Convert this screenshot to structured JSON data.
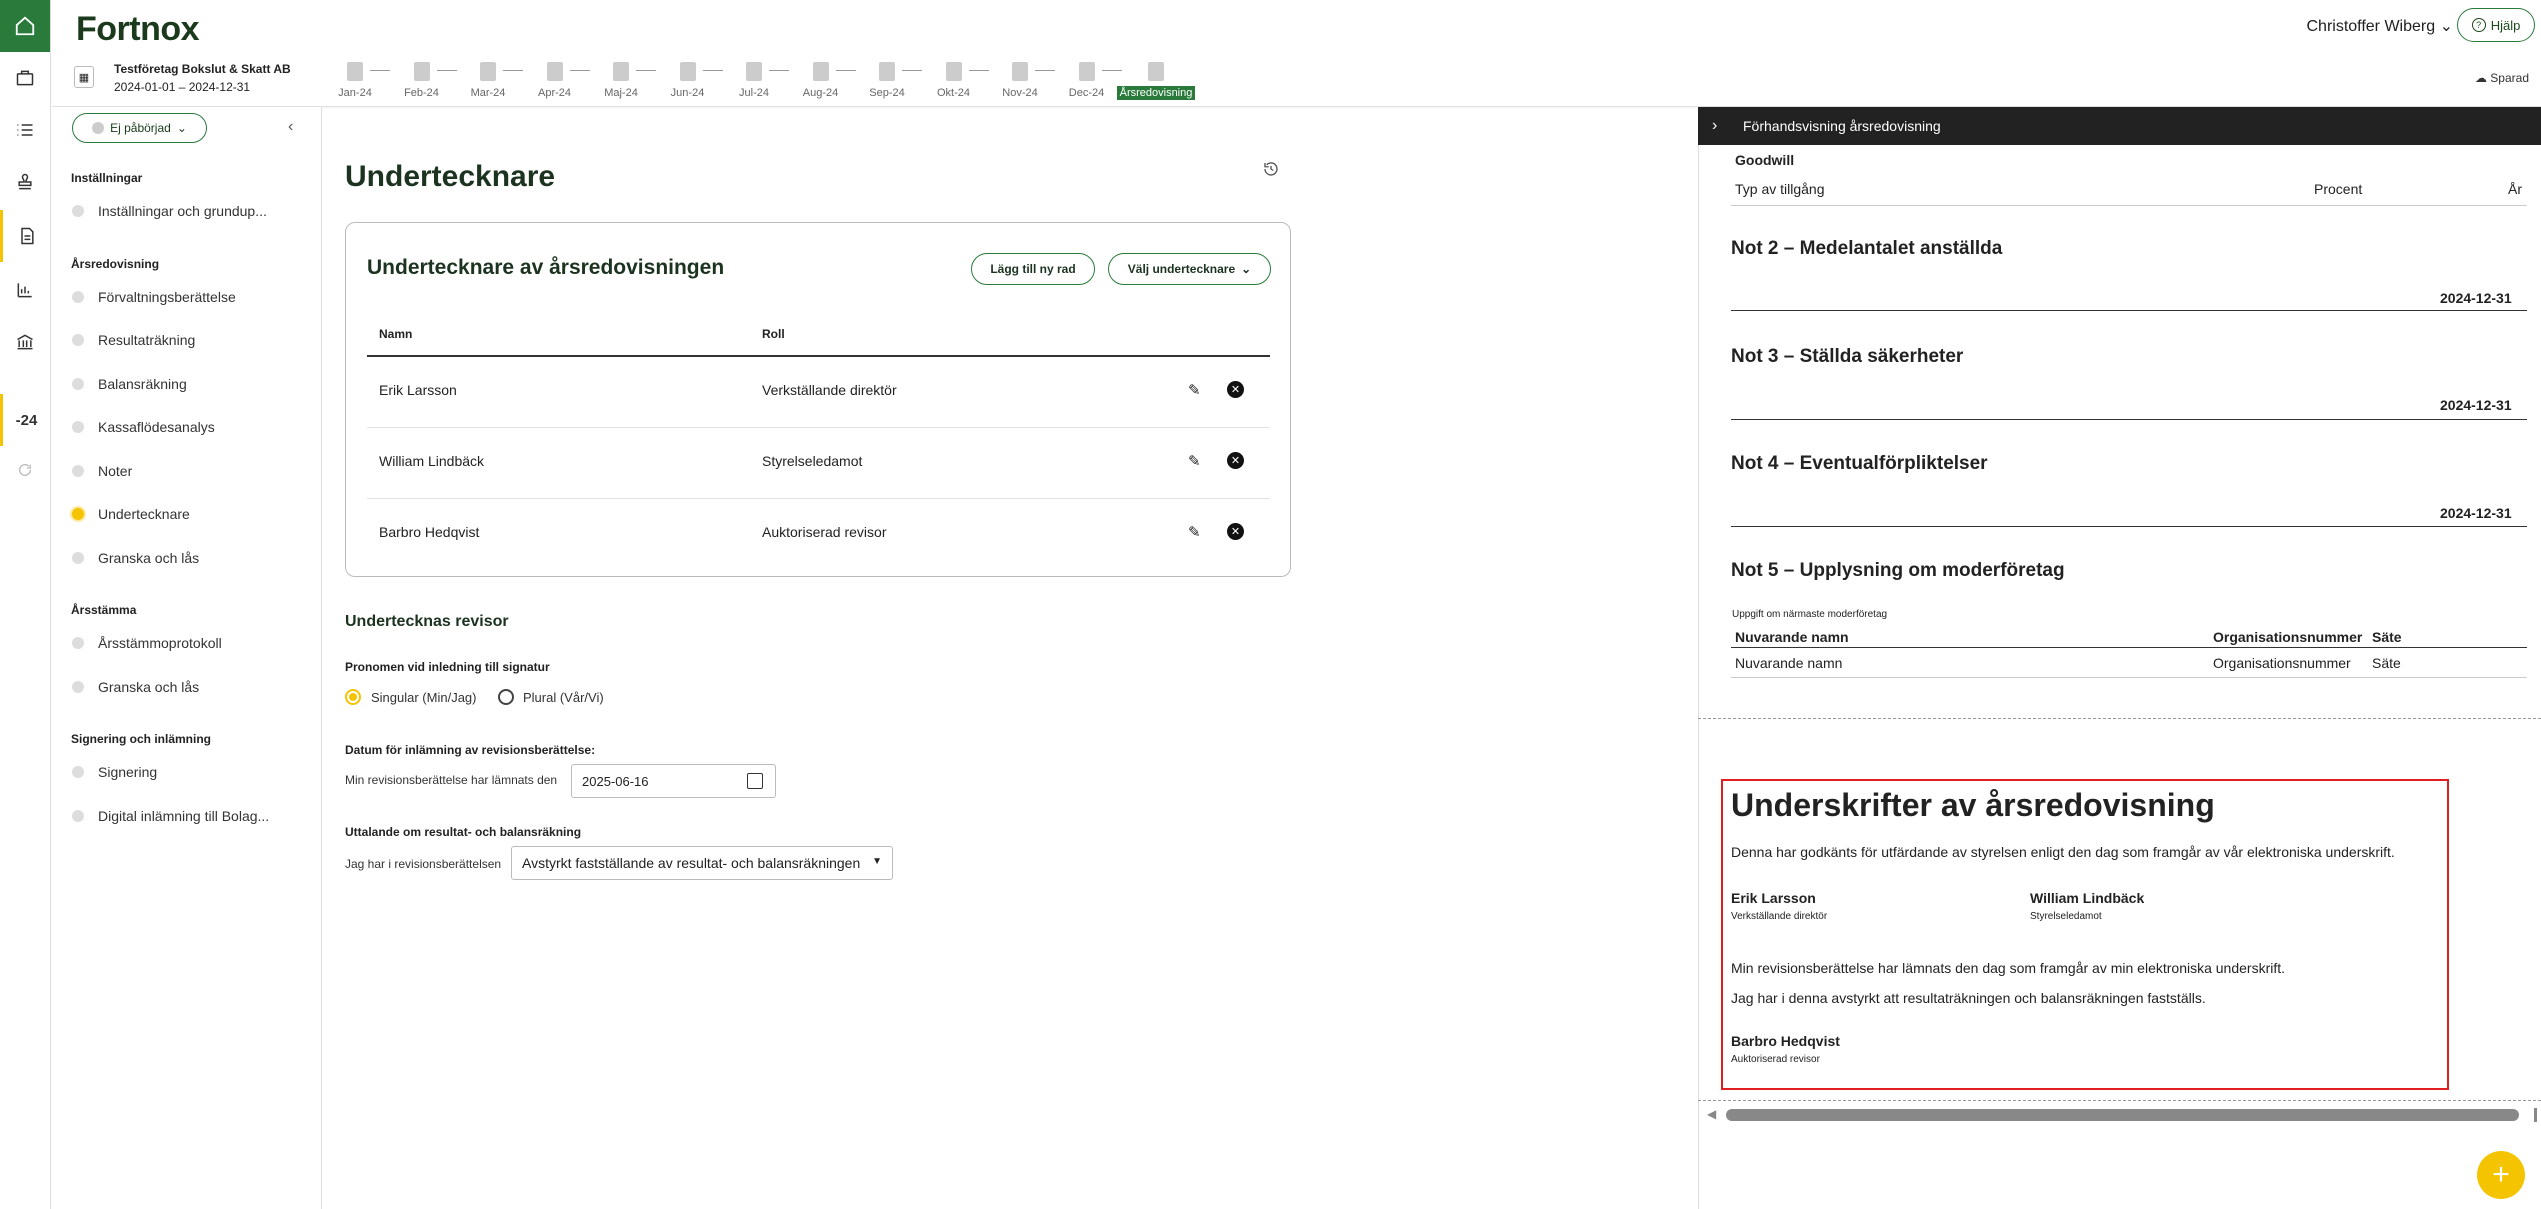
{
  "brand": {
    "name": "Fortnox",
    "accent": "#2a7a3b",
    "highlight": "#f5c400"
  },
  "header": {
    "user": "Christoffer Wiberg",
    "help": "Hjälp",
    "saved": "Sparad"
  },
  "company": {
    "name": "Testföretag Bokslut & Skatt AB",
    "period": "2024-01-01 – 2024-12-31"
  },
  "timeline": [
    "Jan-24",
    "Feb-24",
    "Mar-24",
    "Apr-24",
    "Maj-24",
    "Jun-24",
    "Jul-24",
    "Aug-24",
    "Sep-24",
    "Okt-24",
    "Nov-24",
    "Dec-24",
    "Årsredovisning"
  ],
  "rail": {
    "year_label": "-24",
    "icons": [
      "home-icon",
      "briefcase-icon",
      "list-icon",
      "stamp-icon",
      "document-icon",
      "chart-icon",
      "bank-icon",
      "refresh-icon"
    ]
  },
  "nav": {
    "status": "Ej påbörjad",
    "groups": [
      {
        "title": "Inställningar",
        "items": [
          "Inställningar och grundup..."
        ]
      },
      {
        "title": "Årsredovisning",
        "items": [
          "Förvaltningsberättelse",
          "Resultaträkning",
          "Balansräkning",
          "Kassaflödesanalys",
          "Noter",
          "Undertecknare",
          "Granska och lås"
        ]
      },
      {
        "title": "Årsstämma",
        "items": [
          "Årsstämmoprotokoll",
          "Granska och lås"
        ]
      },
      {
        "title": "Signering och inlämning",
        "items": [
          "Signering",
          "Digital inlämning till Bolag..."
        ]
      }
    ],
    "active": "Undertecknare"
  },
  "main": {
    "title": "Undertecknare",
    "card": {
      "title": "Undertecknare av årsredovisningen",
      "add_row": "Lägg till ny rad",
      "choose": "Välj undertecknare",
      "col_name": "Namn",
      "col_role": "Roll",
      "rows": [
        {
          "name": "Erik Larsson",
          "role": "Verkställande direktör"
        },
        {
          "name": "William Lindbäck",
          "role": "Styrelseledamot"
        },
        {
          "name": "Barbro Hedqvist",
          "role": "Auktoriserad revisor"
        }
      ]
    },
    "auditor": {
      "title": "Undertecknas revisor",
      "pronoun_label": "Pronomen vid inledning till signatur",
      "singular": "Singular (Min/Jag)",
      "plural": "Plural (Vår/Vi)",
      "date_label": "Datum för inlämning av revisionsberättelse:",
      "date_prefix": "Min revisionsberättelse har lämnats den",
      "date_value": "2025-06-16",
      "statement_label": "Uttalande om resultat- och balansräkning",
      "statement_prefix": "Jag har i revisionsberättelsen",
      "statement_value": "Avstyrkt fastställande av resultat- och balansräkningen"
    }
  },
  "preview": {
    "header": "Förhandsvisning årsredovisning",
    "goodwill": "Goodwill",
    "asset_type": "Typ av tillgång",
    "percent": "Procent",
    "year": "År",
    "not2": "Not 2 – Medelantalet anställda",
    "not3": "Not 3 – Ställda säkerheter",
    "not4": "Not 4 – Eventualförpliktelser",
    "not5": "Not 5 – Upplysning om moderföretag",
    "date": "2024-12-31",
    "parent_info": "Uppgift om närmaste moderföretag",
    "col_current": "Nuvarande namn",
    "col_org": "Organisationsnummer",
    "col_seat": "Säte",
    "sig_title": "Underskrifter av årsredovisning",
    "sig_text": "Denna har godkänts för utfärdande av styrelsen enligt den dag som framgår av vår elektroniska underskrift.",
    "sig1_name": "Erik Larsson",
    "sig1_role": "Verkställande direktör",
    "sig2_name": "William Lindbäck",
    "sig2_role": "Styrelseledamot",
    "audit_text1": "Min revisionsberättelse har lämnats den dag som framgår av min elektroniska underskrift.",
    "audit_text2": "Jag har i denna avstyrkt att resultaträkningen och balansräkningen fastställs.",
    "sig3_name": "Barbro Hedqvist",
    "sig3_role": "Auktoriserad revisor"
  }
}
